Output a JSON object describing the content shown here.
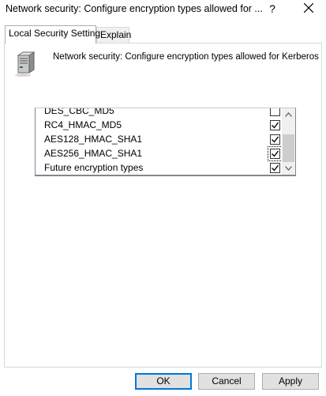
{
  "window": {
    "title": "Network security: Configure encryption types allowed for ...",
    "help_glyph": "?"
  },
  "tabs": [
    {
      "label": "Local Security Setting",
      "active": true
    },
    {
      "label": "Explain",
      "active": false
    }
  ],
  "policy": {
    "icon": "server-tower-icon",
    "name": "Network security: Configure encryption types allowed for Kerberos"
  },
  "encryption_types": [
    {
      "label": "DES_CBC_MD5",
      "checked": false
    },
    {
      "label": "RC4_HMAC_MD5",
      "checked": true
    },
    {
      "label": "AES128_HMAC_SHA1",
      "checked": true
    },
    {
      "label": "AES256_HMAC_SHA1",
      "checked": true,
      "focused": true
    },
    {
      "label": "Future encryption types",
      "checked": true
    }
  ],
  "buttons": {
    "ok": "OK",
    "cancel": "Cancel",
    "apply": "Apply"
  },
  "colors": {
    "accent": "#0078d7",
    "button_face": "#e1e1e1",
    "scrollbar_track": "#f0f0f0",
    "scrollbar_thumb": "#cdcdcd"
  }
}
